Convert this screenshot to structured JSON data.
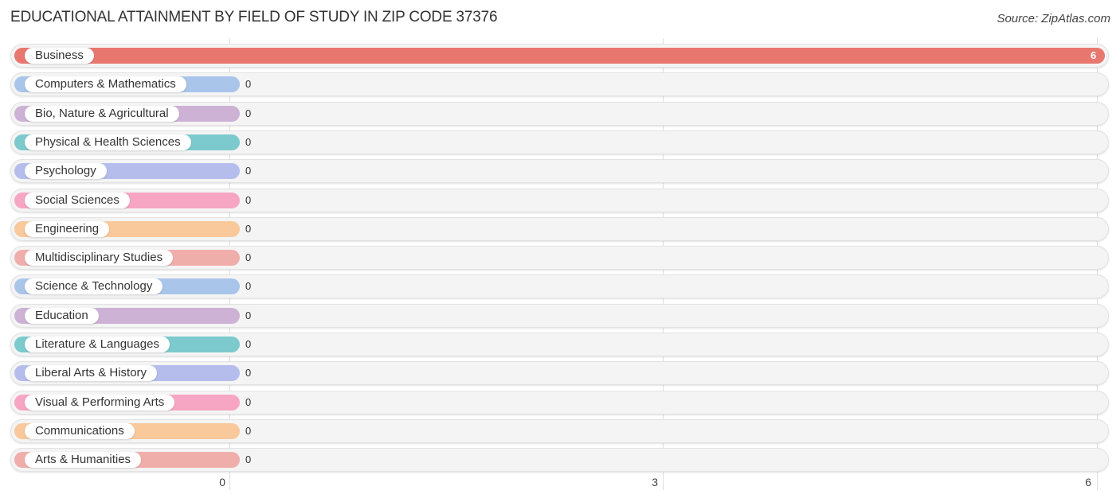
{
  "chart_data": {
    "type": "bar",
    "orientation": "horizontal",
    "title": "EDUCATIONAL ATTAINMENT BY FIELD OF STUDY IN ZIP CODE 37376",
    "source": "Source: ZipAtlas.com",
    "categories": [
      "Business",
      "Computers & Mathematics",
      "Bio, Nature & Agricultural",
      "Physical & Health Sciences",
      "Psychology",
      "Social Sciences",
      "Engineering",
      "Multidisciplinary Studies",
      "Science & Technology",
      "Education",
      "Literature & Languages",
      "Liberal Arts & History",
      "Visual & Performing Arts",
      "Communications",
      "Arts & Humanities"
    ],
    "values": [
      6,
      0,
      0,
      0,
      0,
      0,
      0,
      0,
      0,
      0,
      0,
      0,
      0,
      0,
      0
    ],
    "value_labels": [
      "6",
      "0",
      "0",
      "0",
      "0",
      "0",
      "0",
      "0",
      "0",
      "0",
      "0",
      "0",
      "0",
      "0",
      "0"
    ],
    "colors": [
      "#e8776f",
      "#a9c5ea",
      "#cdb2d6",
      "#7ccacd",
      "#b5bdec",
      "#f6a6c2",
      "#f9c89b",
      "#f0aeab",
      "#a9c5ea",
      "#cdb2d6",
      "#7ccacd",
      "#b5bdec",
      "#f6a6c2",
      "#f9c89b",
      "#f0aeab"
    ],
    "xlim": [
      0,
      6
    ],
    "xticks": [
      "0",
      "3",
      "6"
    ],
    "xtick_values": [
      0,
      3,
      6
    ],
    "grid": true,
    "xlabel": "",
    "ylabel": ""
  }
}
